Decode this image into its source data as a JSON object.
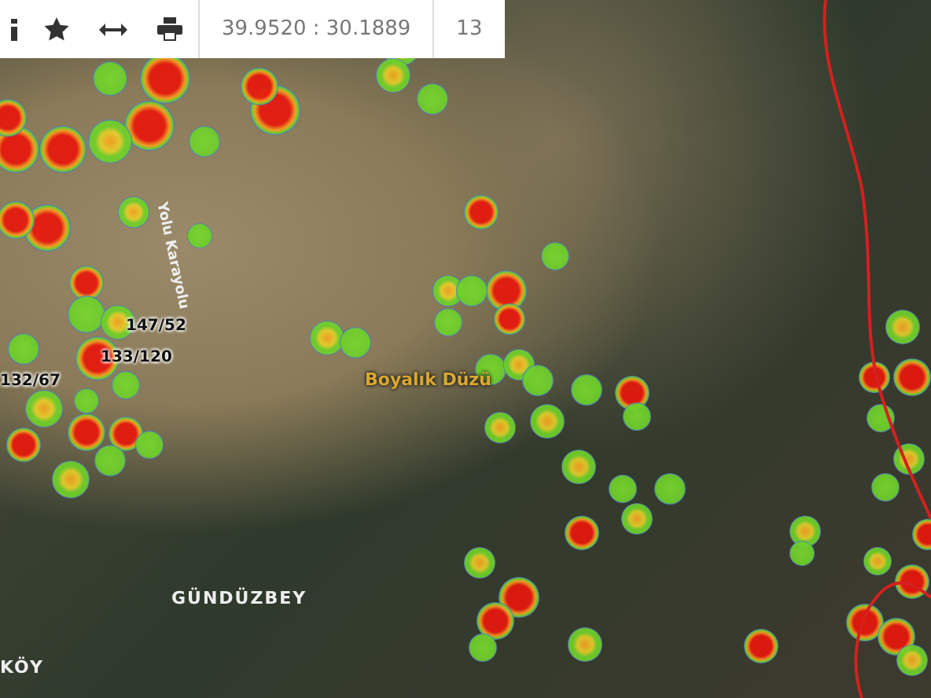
{
  "toolbar": {
    "coordinates": "39.9520 : 30.1889",
    "zoom": "13"
  },
  "map_labels": [
    {
      "text": "147/52",
      "kind": "parcel"
    },
    {
      "text": "133/120",
      "kind": "parcel"
    },
    {
      "text": "132/67",
      "kind": "parcel"
    },
    {
      "text": "Yolu Karayolu",
      "kind": "road"
    },
    {
      "text": "Boyalık Düzü",
      "kind": "locality"
    },
    {
      "text": "GÜNDÜZBEY",
      "kind": "village"
    },
    {
      "text": "KÖY",
      "kind": "village"
    }
  ]
}
